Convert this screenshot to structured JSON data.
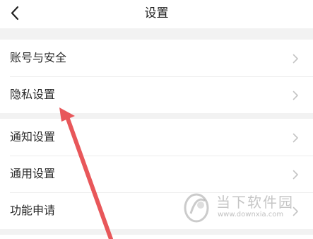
{
  "header": {
    "title": "设置",
    "back_icon": "chevron-left-icon"
  },
  "groups": [
    {
      "items": [
        {
          "label": "账号与安全"
        },
        {
          "label": "隐私设置"
        }
      ]
    },
    {
      "items": [
        {
          "label": "通知设置"
        },
        {
          "label": "通用设置"
        },
        {
          "label": "功能申请"
        }
      ]
    }
  ],
  "item_icon": "chevron-right-icon",
  "annotation": {
    "color": "#e8575a",
    "points_to": "隐私设置"
  },
  "watermark": {
    "name": "当下软件园",
    "url": "www.downxia.com"
  }
}
